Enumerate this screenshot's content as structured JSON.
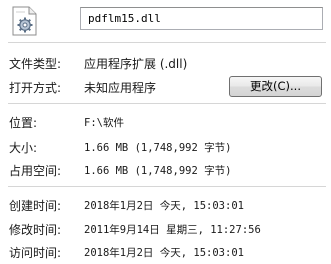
{
  "file": {
    "icon": "dll-file-gear-icon",
    "name": "pdflm15.dll"
  },
  "rows": {
    "type": {
      "label": "文件类型:",
      "value": "应用程序扩展 (.dll)"
    },
    "open_with": {
      "label": "打开方式:",
      "value": "未知应用程序",
      "button": "更改(C)..."
    },
    "location": {
      "label": "位置:",
      "value": "F:\\软件"
    },
    "size": {
      "label": "大小:",
      "value": "1.66 MB (1,748,992 字节)"
    },
    "size_on_disk": {
      "label": "占用空间:",
      "value": "1.66 MB (1,748,992 字节)"
    },
    "created": {
      "label": "创建时间:",
      "value": "2018年1月2日 今天, 15:03:01"
    },
    "modified": {
      "label": "修改时间:",
      "value": "2011年9月14日 星期三, 11:27:56"
    },
    "accessed": {
      "label": "访问时间:",
      "value": "2018年1月2日 今天, 15:03:01"
    }
  }
}
